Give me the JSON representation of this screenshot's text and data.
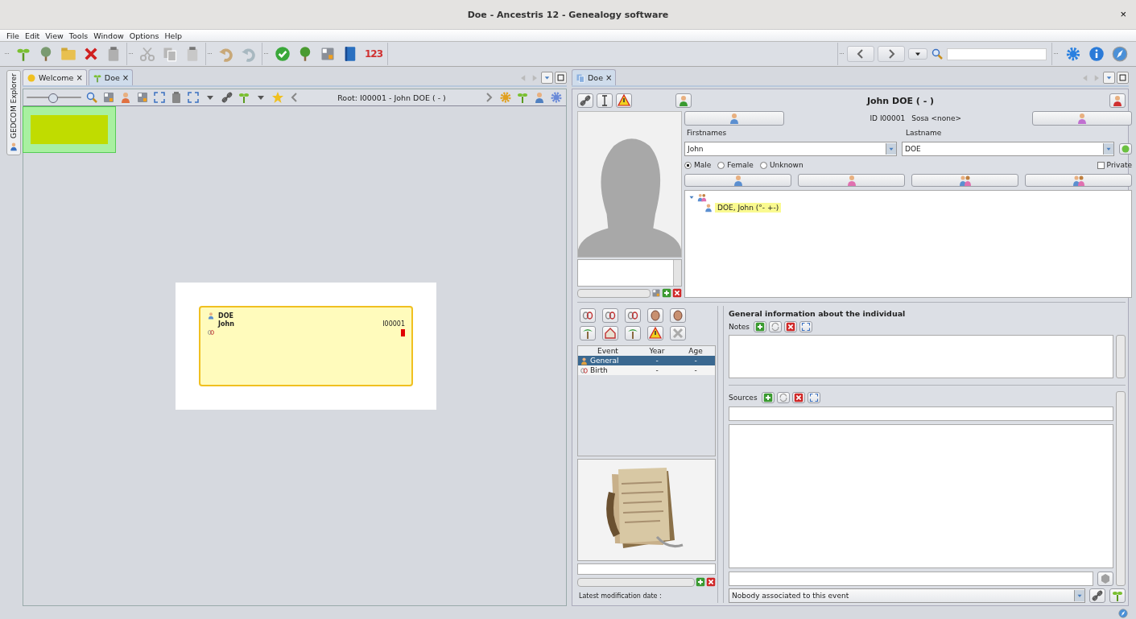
{
  "window": {
    "title": "Doe - Ancestris 12 - Genealogy software",
    "close": "×"
  },
  "menu": [
    "File",
    "Edit",
    "View",
    "Tools",
    "Window",
    "Options",
    "Help"
  ],
  "toolbar": {
    "numbering_label": "123"
  },
  "side_tab": {
    "label": "GEDCOM Explorer"
  },
  "left_tabs": [
    {
      "label": "Welcome",
      "selected": false,
      "close": "×"
    },
    {
      "label": "Doe",
      "selected": true,
      "close": "×"
    }
  ],
  "tree_view": {
    "zoom": {
      "level": 0.47
    },
    "root_label": "Root: I00001 - John DOE ( - )",
    "card": {
      "lastname": "DOE",
      "firstname": "John",
      "id": "I00001"
    }
  },
  "right_tabs": [
    {
      "label": "Doe",
      "selected": true,
      "close": "×"
    }
  ],
  "editor": {
    "title": "John DOE ( - )",
    "id": "ID I00001",
    "sosa": "Sosa <none>",
    "firstnames_label": "Firstnames",
    "firstnames": "John",
    "lastname_label": "Lastname",
    "lastname": "DOE",
    "sex": [
      {
        "label": "Male",
        "selected": true
      },
      {
        "label": "Female",
        "selected": false
      },
      {
        "label": "Unknown",
        "selected": false
      }
    ],
    "private": {
      "label": "Private",
      "checked": false
    },
    "family": {
      "expanded": true,
      "children": [
        {
          "label": "DOE, John (°- +-)",
          "selected": true
        }
      ]
    },
    "events": {
      "columns": [
        "Event",
        "Year",
        "Age"
      ],
      "rows": [
        {
          "event": "General",
          "year": "-",
          "age": "-",
          "selected": true
        },
        {
          "event": "Birth",
          "year": "-",
          "age": "-",
          "selected": false
        }
      ]
    },
    "modification_label": "Latest modification date :",
    "info_title": "General information about the individual",
    "notes_label": "Notes",
    "sources_label": "Sources",
    "association": "Nobody associated to this event"
  }
}
